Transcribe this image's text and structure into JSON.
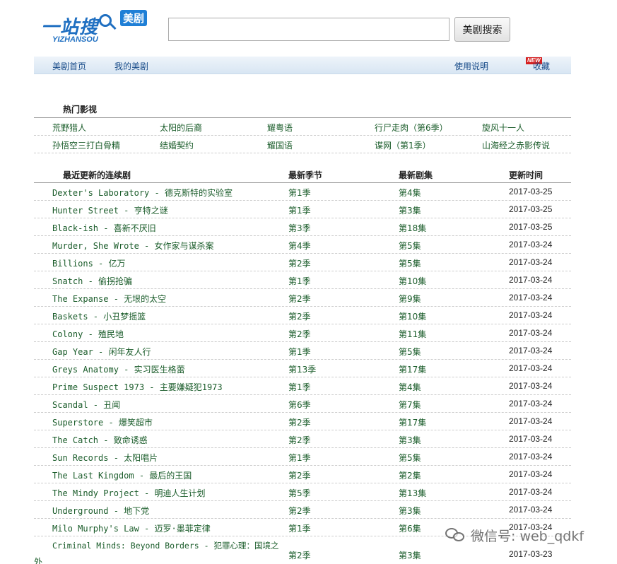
{
  "logo": {
    "cn": "一站搜",
    "en": "YIZHANSOU",
    "badge": "美剧"
  },
  "search": {
    "value": "",
    "placeholder": "",
    "button_label": "美剧搜索"
  },
  "nav": {
    "left": [
      "美剧首页",
      "我的美剧"
    ],
    "help": "使用说明",
    "help_badge": "NEW",
    "favorite": "收藏"
  },
  "hot": {
    "title": "热门影视",
    "rows": [
      [
        "荒野猎人",
        "太阳的后裔",
        "耀粤语",
        "行尸走肉（第6季）",
        "旋风十一人"
      ],
      [
        "孙悟空三打白骨精",
        "结婚契约",
        "耀国语",
        "谍网（第1季）",
        "山海经之赤影传说"
      ]
    ]
  },
  "updates": {
    "headers": [
      "最近更新的连续剧",
      "最新季节",
      "最新剧集",
      "更新时间"
    ],
    "rows": [
      {
        "title": "Dexter's Laboratory - 德克斯特的实验室",
        "season": "第1季",
        "episode": "第4集",
        "date": "2017-03-25"
      },
      {
        "title": "Hunter Street - 亨特之谜",
        "season": "第1季",
        "episode": "第3集",
        "date": "2017-03-25"
      },
      {
        "title": "Black-ish - 喜新不厌旧",
        "season": "第3季",
        "episode": "第18集",
        "date": "2017-03-25"
      },
      {
        "title": "Murder, She Wrote - 女作家与谋杀案",
        "season": "第4季",
        "episode": "第5集",
        "date": "2017-03-24"
      },
      {
        "title": "Billions - 亿万",
        "season": "第2季",
        "episode": "第5集",
        "date": "2017-03-24"
      },
      {
        "title": "Snatch - 偷拐抢骗",
        "season": "第1季",
        "episode": "第10集",
        "date": "2017-03-24"
      },
      {
        "title": "The Expanse - 无垠的太空",
        "season": "第2季",
        "episode": "第9集",
        "date": "2017-03-24"
      },
      {
        "title": "Baskets - 小丑梦摇篮",
        "season": "第2季",
        "episode": "第10集",
        "date": "2017-03-24"
      },
      {
        "title": "Colony - 殖民地",
        "season": "第2季",
        "episode": "第11集",
        "date": "2017-03-24"
      },
      {
        "title": "Gap Year - 闲年友人行",
        "season": "第1季",
        "episode": "第5集",
        "date": "2017-03-24"
      },
      {
        "title": "Greys Anatomy - 实习医生格蕾",
        "season": "第13季",
        "episode": "第17集",
        "date": "2017-03-24"
      },
      {
        "title": "Prime Suspect 1973 - 主要嫌疑犯1973",
        "season": "第1季",
        "episode": "第4集",
        "date": "2017-03-24"
      },
      {
        "title": "Scandal - 丑闻",
        "season": "第6季",
        "episode": "第7集",
        "date": "2017-03-24"
      },
      {
        "title": "Superstore - 爆笑超市",
        "season": "第2季",
        "episode": "第17集",
        "date": "2017-03-24"
      },
      {
        "title": "The Catch - 致命诱惑",
        "season": "第2季",
        "episode": "第3集",
        "date": "2017-03-24"
      },
      {
        "title": "Sun Records - 太阳唱片",
        "season": "第1季",
        "episode": "第5集",
        "date": "2017-03-24"
      },
      {
        "title": "The Last Kingdom - 最后的王国",
        "season": "第2季",
        "episode": "第2集",
        "date": "2017-03-24"
      },
      {
        "title": "The Mindy Project - 明迪人生计划",
        "season": "第5季",
        "episode": "第13集",
        "date": "2017-03-24"
      },
      {
        "title": "Underground - 地下党",
        "season": "第2季",
        "episode": "第3集",
        "date": "2017-03-24"
      },
      {
        "title": "Milo Murphy's Law - 迈罗·墨菲定律",
        "season": "第1季",
        "episode": "第6集",
        "date": "2017-03-24"
      }
    ],
    "last_row": {
      "title": "Criminal Minds: Beyond Borders - 犯罪心理：国境之",
      "title_wrap": "外",
      "season": "第2季",
      "episode": "第3集",
      "date": "2017-03-23"
    }
  },
  "watermark": {
    "text": "微信号: web_qdkf",
    "icon": "wechat-icon"
  }
}
